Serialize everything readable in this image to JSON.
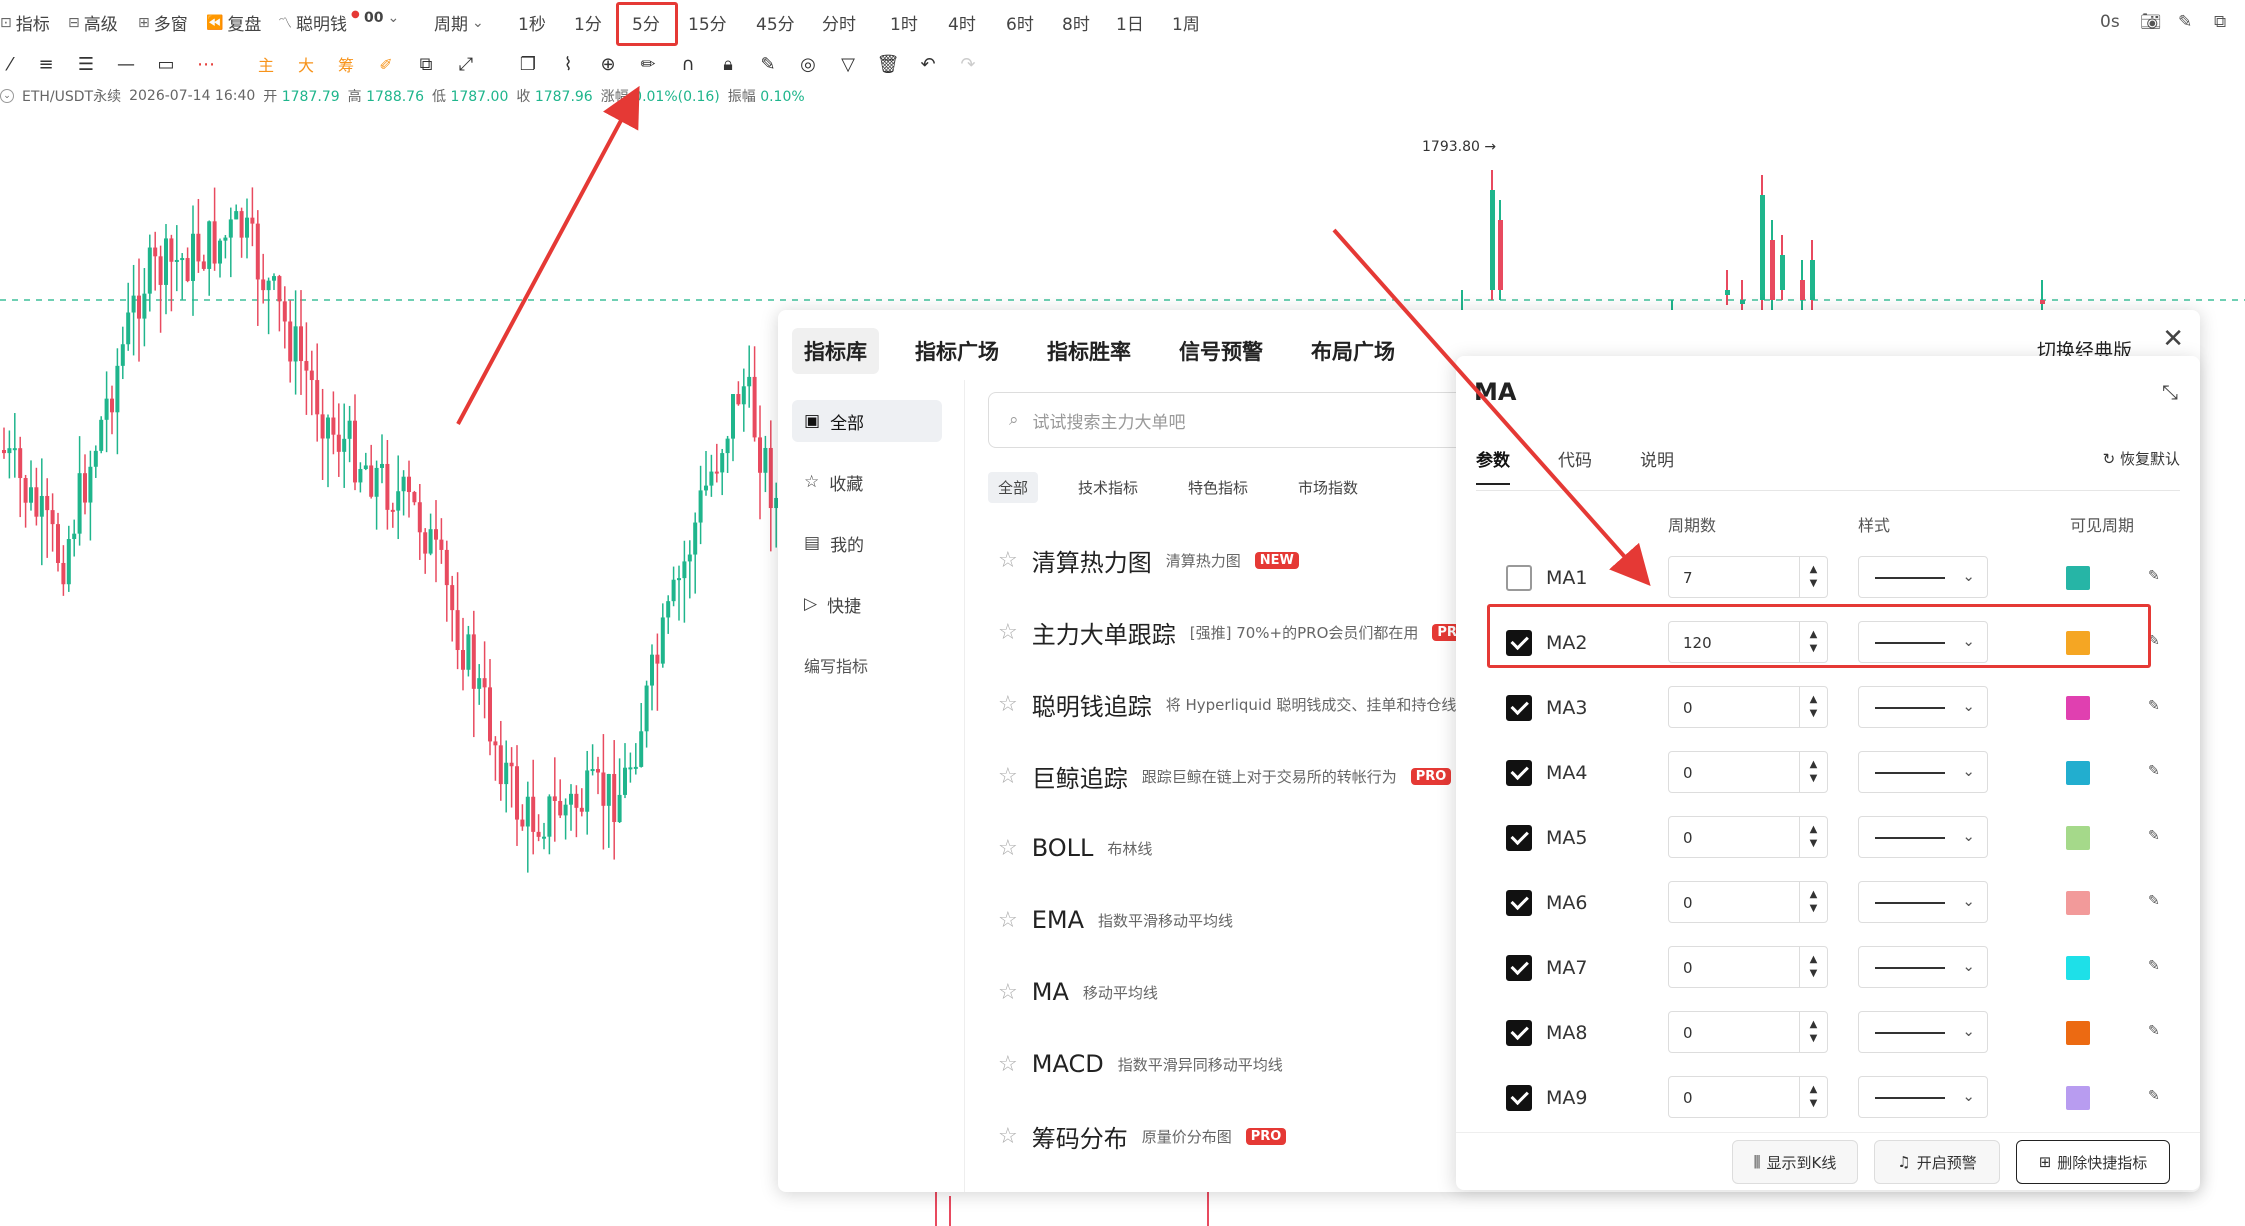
{
  "toolbar": {
    "items": [
      {
        "icon": "indicator-icon",
        "label": "指标"
      },
      {
        "icon": "advanced-icon",
        "label": "高级"
      },
      {
        "icon": "multi-window-icon",
        "label": "多窗"
      },
      {
        "icon": "replay-icon",
        "label": "复盘"
      },
      {
        "icon": "smart-money-icon",
        "label": "聪明钱"
      }
    ],
    "oo_label": "00",
    "period_label": "周期",
    "intervals": [
      "1秒",
      "1分",
      "5分",
      "15分",
      "45分",
      "分时",
      "1时",
      "4时",
      "6时",
      "8时",
      "1日",
      "1周"
    ],
    "selected_interval": "5分",
    "countdown": "0s"
  },
  "drawing_tools": {
    "main_label": "主",
    "large_label": "大",
    "chip_label": "筹"
  },
  "ticker": {
    "symbol": "ETH/USDT永续",
    "datetime": "2026-07-14 16:40",
    "open_label": "开",
    "open": "1787.79",
    "high_label": "高",
    "high": "1788.76",
    "low_label": "低",
    "low": "1787.00",
    "close_label": "收",
    "close": "1787.96",
    "change_label": "涨幅",
    "change": "0.01%(0.16)",
    "amp_label": "振幅",
    "amp": "0.10%"
  },
  "price_marker": "1793.80",
  "colors": {
    "up": "#1fb58c",
    "down": "#e84a5f",
    "highlight": "#e53935",
    "dash": "#3fbf9a"
  },
  "indicator_panel": {
    "tabs": [
      "指标库",
      "指标广场",
      "指标胜率",
      "信号预警",
      "布局广场"
    ],
    "active_tab": "指标库",
    "switch_label": "切换经典版",
    "sidebar": [
      {
        "icon": "all-icon",
        "label": "全部"
      },
      {
        "icon": "star-icon",
        "label": "收藏"
      },
      {
        "icon": "mine-icon",
        "label": "我的"
      },
      {
        "icon": "quick-icon",
        "label": "快捷"
      },
      {
        "icon": "",
        "label": "编写指标"
      }
    ],
    "search_placeholder": "试试搜索主力大单吧",
    "filters": [
      "全部",
      "技术指标",
      "特色指标",
      "市场指数"
    ],
    "indicators": [
      {
        "name": "清算热力图",
        "desc": "清算热力图",
        "badge": "NEW"
      },
      {
        "name": "主力大单跟踪",
        "desc": "[强推] 70%+的PRO会员们都在用",
        "badge": "PRO"
      },
      {
        "name": "聪明钱追踪",
        "desc": "将 Hyperliquid 聪明钱成交、挂单和持仓线",
        "badge": ""
      },
      {
        "name": "巨鲸追踪",
        "desc": "跟踪巨鲸在链上对于交易所的转帐行为",
        "badge": "PRO"
      },
      {
        "name": "BOLL",
        "desc": "布林线",
        "badge": ""
      },
      {
        "name": "EMA",
        "desc": "指数平滑移动平均线",
        "badge": ""
      },
      {
        "name": "MA",
        "desc": "移动平均线",
        "badge": ""
      },
      {
        "name": "MACD",
        "desc": "指数平滑异同移动平均线",
        "badge": ""
      },
      {
        "name": "筹码分布",
        "desc": "原量价分布图",
        "badge": "PRO"
      }
    ]
  },
  "ma_dialog": {
    "title": "MA",
    "tabs": [
      "参数",
      "代码",
      "说明"
    ],
    "restore_label": "恢复默认",
    "col_period": "周期数",
    "col_style": "样式",
    "col_visible": "可见周期",
    "rows": [
      {
        "name": "MA1",
        "checked": false,
        "period": "7",
        "color": "#26b5a6"
      },
      {
        "name": "MA2",
        "checked": true,
        "period": "120",
        "color": "#f5a623"
      },
      {
        "name": "MA3",
        "checked": true,
        "period": "0",
        "color": "#e040b0"
      },
      {
        "name": "MA4",
        "checked": true,
        "period": "0",
        "color": "#22aecf"
      },
      {
        "name": "MA5",
        "checked": true,
        "period": "0",
        "color": "#a5d98a"
      },
      {
        "name": "MA6",
        "checked": true,
        "period": "0",
        "color": "#f29a9a"
      },
      {
        "name": "MA7",
        "checked": true,
        "period": "0",
        "color": "#1ee0e8"
      },
      {
        "name": "MA8",
        "checked": true,
        "period": "0",
        "color": "#ec6a12"
      },
      {
        "name": "MA9",
        "checked": true,
        "period": "0",
        "color": "#b89cf0"
      }
    ],
    "footer": {
      "show_kline": "显示到K线",
      "alert": "开启预警",
      "delete_quick": "删除快捷指标"
    }
  }
}
